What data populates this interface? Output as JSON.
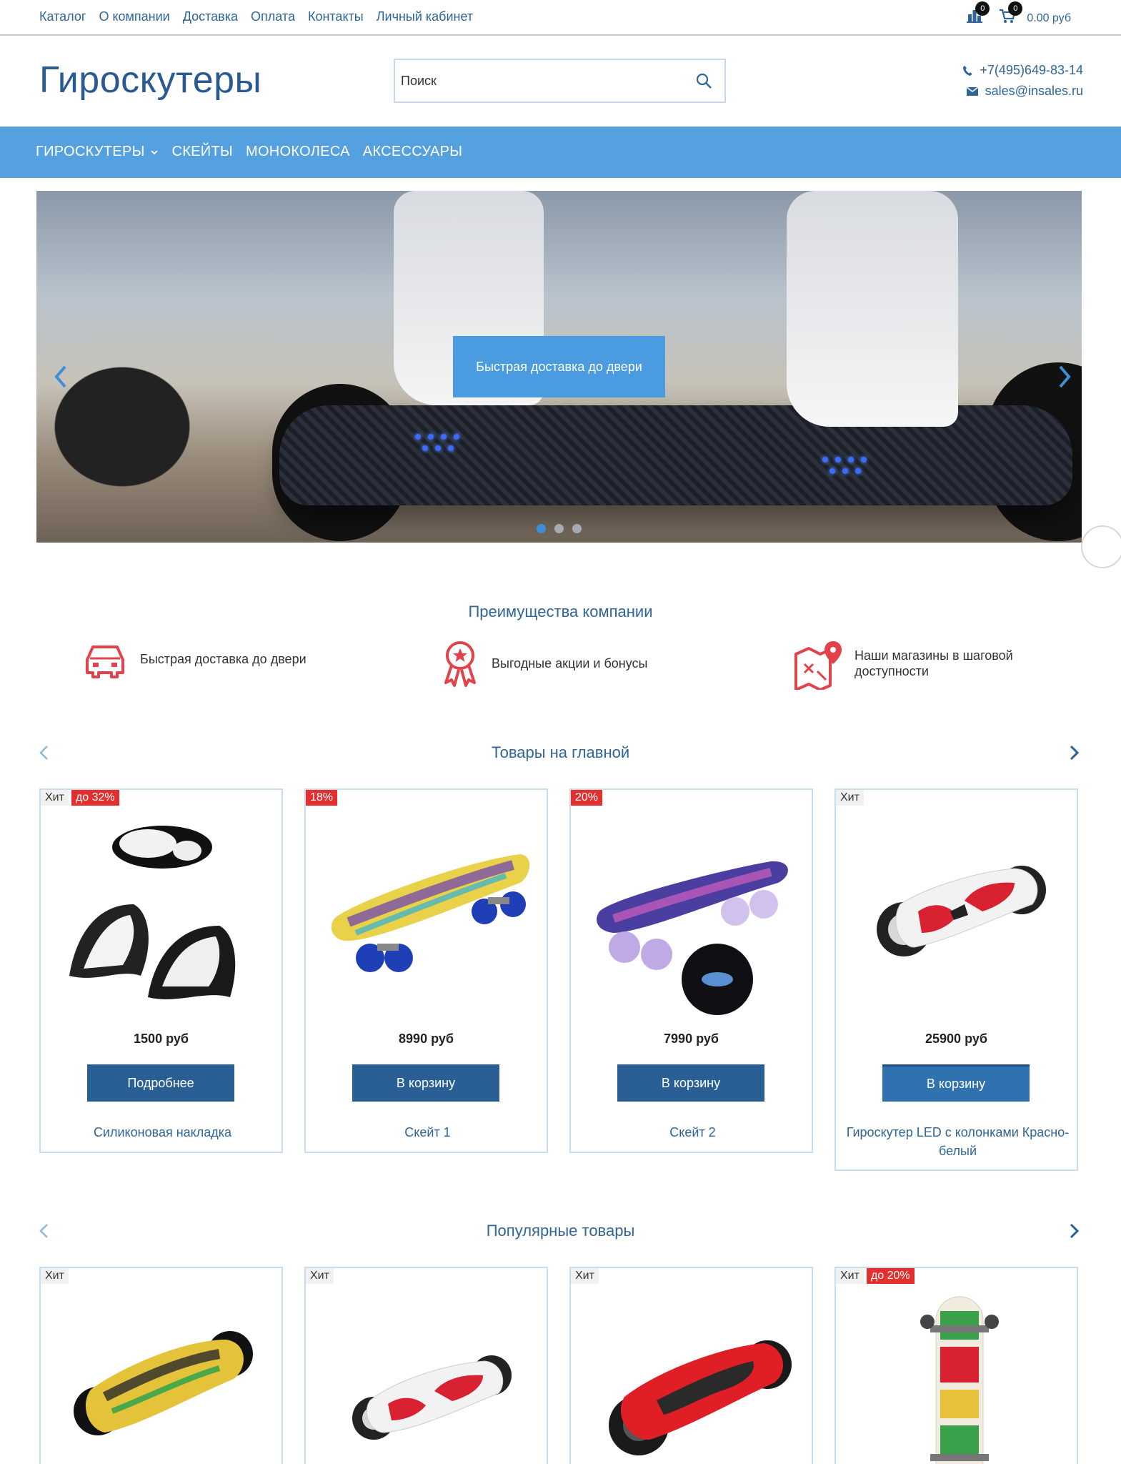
{
  "topnav": [
    "Каталог",
    "О компании",
    "Доставка",
    "Оплата",
    "Контакты",
    "Личный кабинет"
  ],
  "top_icons": {
    "compare_count": "0",
    "cart_count": "0",
    "cart_sum": "0.00 руб"
  },
  "logo": "Гироскутеры",
  "search": {
    "placeholder": "Поиск"
  },
  "contacts": {
    "phone": "+7(495)649-83-14",
    "email": "sales@insales.ru"
  },
  "menu": [
    "ГИРОСКУТЕРЫ",
    "СКЕЙТЫ",
    "МОНОКОЛЕСА",
    "АКСЕССУАРЫ"
  ],
  "hero": {
    "cta": "Быстрая доставка до двери",
    "slides": 3,
    "active_slide": 1
  },
  "advantages": {
    "title": "Преимущества компании",
    "items": [
      "Быстрая доставка до двери",
      "Выгодные акции и бонусы",
      "Наши магазины в шаговой доступности"
    ]
  },
  "featured": {
    "title": "Товары на главной",
    "products": [
      {
        "badges": [
          "Хит",
          "до 32%"
        ],
        "price": "1500 руб",
        "button": "Подробнее",
        "name": "Силиконовая накладка"
      },
      {
        "badges": [
          "18%"
        ],
        "price": "8990 руб",
        "button": "В корзину",
        "name": "Скейт 1"
      },
      {
        "badges": [
          "20%"
        ],
        "price": "7990 руб",
        "button": "В корзину",
        "name": "Скейт 2"
      },
      {
        "badges": [
          "Хит"
        ],
        "price": "25900 руб",
        "button": "В корзину",
        "name": "Гироскутер LED с колонками Красно-белый"
      }
    ]
  },
  "popular": {
    "title": "Популярные товары",
    "products": [
      {
        "badges": [
          "Хит"
        ]
      },
      {
        "badges": [
          "Хит"
        ]
      },
      {
        "badges": [
          "Хит"
        ]
      },
      {
        "badges": [
          "Хит",
          "до 20%"
        ]
      }
    ]
  },
  "colors": {
    "brand": "#2f6598",
    "nav": "#55a1e0",
    "button": "#2a5f95",
    "sale": "#e3302e",
    "advantage_icon": "#e2434b"
  }
}
